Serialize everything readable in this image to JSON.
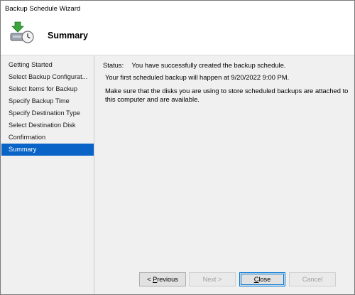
{
  "window": {
    "title": "Backup Schedule Wizard"
  },
  "header": {
    "title": "Summary",
    "icon": "backup-clock-icon"
  },
  "nav": {
    "items": [
      {
        "label": "Getting Started",
        "active": false
      },
      {
        "label": "Select Backup Configurat...",
        "active": false
      },
      {
        "label": "Select Items for Backup",
        "active": false
      },
      {
        "label": "Specify Backup Time",
        "active": false
      },
      {
        "label": "Specify Destination Type",
        "active": false
      },
      {
        "label": "Select Destination Disk",
        "active": false
      },
      {
        "label": "Confirmation",
        "active": false
      },
      {
        "label": "Summary",
        "active": true
      }
    ]
  },
  "content": {
    "status_label": "Status:",
    "status_text": "You have successfully created the backup schedule.",
    "first_backup": "Your first scheduled backup will happen at 9/20/2022 9:00 PM.",
    "disk_note": "Make sure that the disks you are using to store scheduled backups are attached to this computer and are available."
  },
  "buttons": {
    "previous": {
      "mnemonic": "P",
      "rest": "revious",
      "prefix": "< ",
      "enabled": true
    },
    "next": {
      "label": "Next >",
      "enabled": false
    },
    "close": {
      "mnemonic": "C",
      "rest": "lose",
      "enabled": true,
      "default": true
    },
    "cancel": {
      "label": "Cancel",
      "enabled": false
    }
  },
  "colors": {
    "selection": "#0a64c8",
    "default_button_border": "#0078d7"
  }
}
